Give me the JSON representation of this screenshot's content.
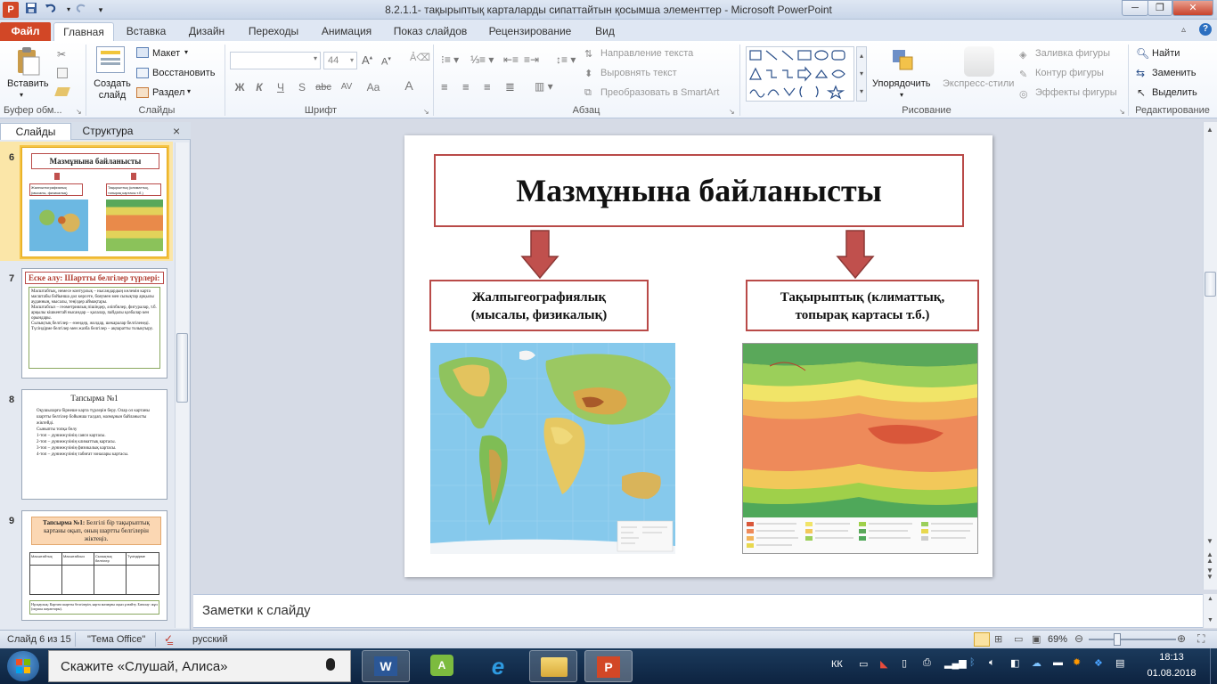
{
  "window": {
    "title": "8.2.1.1- тақырыптық карталарды сипаттайтын қосымша элементтер  -  Microsoft PowerPoint",
    "controls": [
      "minimize",
      "restore",
      "close"
    ]
  },
  "quick_access": {
    "icons": [
      "powerpoint-logo-icon",
      "save-icon",
      "undo-icon",
      "redo-icon",
      "customize-icon"
    ]
  },
  "ribbon_tabs": [
    "Файл",
    "Главная",
    "Вставка",
    "Дизайн",
    "Переходы",
    "Анимация",
    "Показ слайдов",
    "Рецензирование",
    "Вид"
  ],
  "active_tab": "Главная",
  "ribbon": {
    "clipboard": {
      "paste": "Вставить",
      "label": "Буфер обм..."
    },
    "slides": {
      "new_slide": "Создать слайд",
      "layout": "Макет",
      "reset": "Восстановить",
      "section": "Раздел",
      "label": "Слайды"
    },
    "font": {
      "size": "44",
      "bold": "Ж",
      "italic": "К",
      "underline": "Ч",
      "shadow": "S",
      "strike": "abc",
      "spacing": "AV",
      "case": "Aa",
      "color": "A",
      "label": "Шрифт"
    },
    "paragraph": {
      "text_direction": "Направление текста",
      "align_text": "Выровнять текст",
      "smartart": "Преобразовать в SmartArt",
      "label": "Абзац"
    },
    "drawing": {
      "arrange": "Упорядочить",
      "quick_styles": "Экспресс-стили",
      "fill": "Заливка фигуры",
      "outline": "Контур фигуры",
      "effects": "Эффекты фигуры",
      "label": "Рисование"
    },
    "editing": {
      "find": "Найти",
      "replace": "Заменить",
      "select": "Выделить",
      "label": "Редактирование"
    }
  },
  "left_pane": {
    "tabs": [
      "Слайды",
      "Структура"
    ],
    "close": "×",
    "thumbnails": [
      {
        "num": "6",
        "title": "Мазмұнына байланысты",
        "box_left": "Жалпыгеографиялық (мысалы, физикалық)",
        "box_right": "Тақырыптық (климаттық, топырақ картасы т.б.)"
      },
      {
        "num": "7",
        "title": "Еске алу: Шартты белгілер түрлері:",
        "bullets": [
          "Масштабтық, немесе контурлық – нысандардың көлемін карта масштабы бойынша дәл көрсете, бояумен мен сызықтар арқылы ауданның, мысалы, теңіздер аймақтары.",
          "Масштабсыз – геометриялық пішіндер, әліпбилер, фигуралар, т.б. арқылы кішкентай нысандар – қалалар, пайдалы қазбалар кен орындары.",
          "Сызықтық белгілер – өзендер, жолдар, шекаралар белгіленеді.",
          "Түсіндірме белгілер мен жазба белгілер – ақпаратты толықтыру."
        ]
      },
      {
        "num": "8",
        "title": "Тапсырма №1",
        "bullets": [
          "Оқушыларға бірнеше карта түрлерін беру. Олар ол картаны шартты белгілер бойынша талдап, мазмұнын байланысты жіктейді.",
          "Сыныпты топқа бөлу",
          "1-топ – дүниежүзінің саяси картасы.",
          "2-топ – дүниежүзінің климаттық картасы.",
          "3-топ – дүниежүзінің физикалық картасы.",
          "4-топ – дүниежүзінің табиғат зоналары картасы."
        ]
      },
      {
        "num": "9",
        "title_bold": "Тапсырма №1:",
        "title_rest": " Белгілі бір тақырыптық картаны оқып, оның шартты белгілерін жіктеңіз.",
        "headers": [
          "Масштабтық",
          "Масштабсыз",
          "Сызықтық белгілер",
          "Түсіндірме"
        ],
        "footer": "Нұсқаулық: Картаға шартты белгілерін, карта мазмұны оқып ұлғайту. Бағалау: жұп (оқушы жауаптары)."
      }
    ]
  },
  "slide": {
    "title": "Мазмұнына байланысты",
    "left_box": {
      "line1": "Жалпыгеографиялық",
      "line2": "(мысалы, физикалық)"
    },
    "right_box": {
      "line1": "Тақырыптық  (климаттық,",
      "line2": "топырақ картасы т.б.)"
    },
    "colors": {
      "border": "#b94a48",
      "arrow": "#c0504d"
    }
  },
  "notes": {
    "placeholder": "Заметки к слайду"
  },
  "status_bar": {
    "slide_info": "Слайд 6 из 15",
    "theme": "\"Тема Office\"",
    "language": "русский",
    "zoom": "69%"
  },
  "taskbar": {
    "search_placeholder": "Скажите «Слушай, Алиса»",
    "apps": [
      "word-icon",
      "android-studio-icon",
      "ie-icon",
      "file-explorer-icon",
      "powerpoint-icon"
    ],
    "lang": "КК",
    "time": "18:13",
    "date": "01.08.2018"
  }
}
